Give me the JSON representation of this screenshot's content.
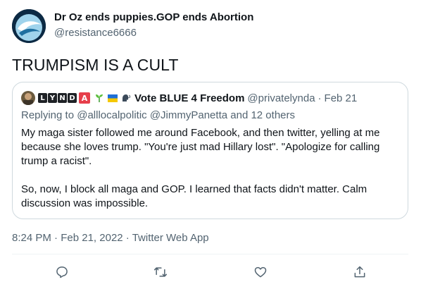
{
  "author": {
    "name": "Dr Oz ends puppies.GOP ends Abortion",
    "handle": "@resistance6666"
  },
  "tweet_text": "TRUMPISM IS A CULT",
  "quoted": {
    "badges": [
      "L",
      "Y",
      "N",
      "D",
      "A"
    ],
    "name": "Vote BLUE 4 Freedom",
    "handle": "@privatelynda",
    "separator": "·",
    "date": "Feb 21",
    "reply_prefix": "Replying to",
    "reply_mentions": "@alllocalpolitic @JimmyPanetta",
    "reply_suffix": "and 12 others",
    "paragraphs": [
      "My maga sister followed me around Facebook, and then twitter, yelling at me because she loves trump. \"You're just mad Hillary lost\". \"Apologize for calling trump a racist\".",
      "So, now, I block all maga and GOP. I learned that facts didn't matter. Calm discussion was impossible."
    ]
  },
  "meta": {
    "time": "8:24 PM",
    "separator": "·",
    "date": "Feb 21, 2022",
    "app": "Twitter Web App"
  },
  "actions": [
    {
      "icon": "reply-icon"
    },
    {
      "icon": "retweet-icon"
    },
    {
      "icon": "like-icon"
    },
    {
      "icon": "share-icon"
    }
  ],
  "colors": {
    "text": "#0f1419",
    "secondary": "#536471",
    "border": "#cfd9de",
    "badge_red": "#e63e4a"
  }
}
